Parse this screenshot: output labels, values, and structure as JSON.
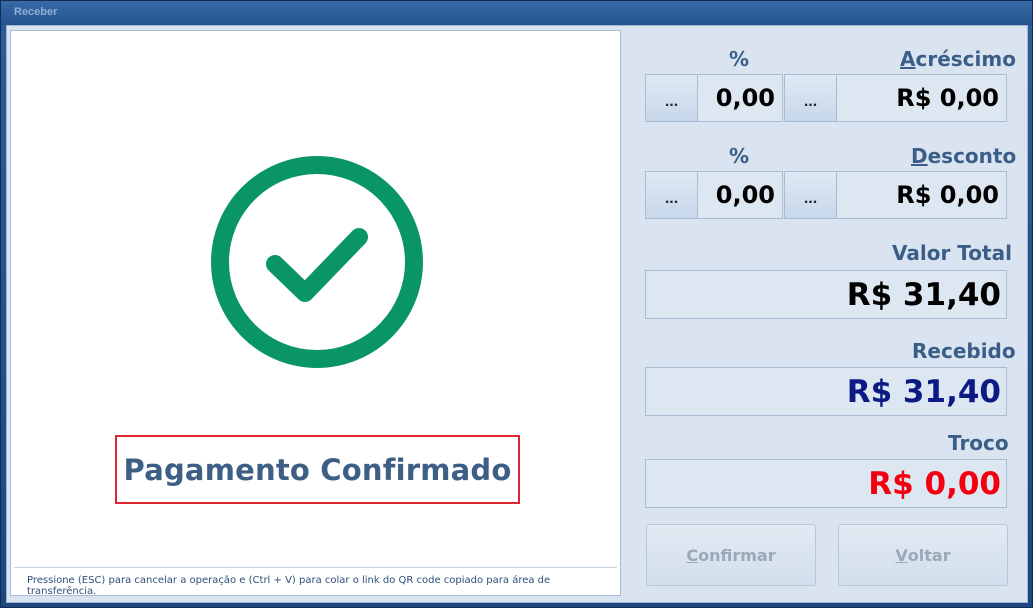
{
  "window": {
    "title": "Receber"
  },
  "status": {
    "message": "Pagamento Confirmado",
    "icon": "check-circle-icon",
    "icon_color": "#0a9567"
  },
  "hint": "Pressione (ESC) para cancelar a operação e (Ctrl + V) para colar o link do QR code copiado para área de transferência.",
  "acrescimo": {
    "percent_label": "%",
    "label_access": "A",
    "label_rest": "créscimo",
    "dots": "...",
    "percent_value": "0,00",
    "value": "R$ 0,00"
  },
  "desconto": {
    "percent_label": "%",
    "label_access": "D",
    "label_rest": "esconto",
    "dots": "...",
    "percent_value": "0,00",
    "value": "R$ 0,00"
  },
  "valor_total": {
    "label": "Valor Total",
    "value": "R$ 31,40",
    "color": "#000000"
  },
  "recebido": {
    "label": "Recebido",
    "value": "R$ 31,40",
    "color": "#0c1a86"
  },
  "troco": {
    "label": "Troco",
    "value": "R$ 0,00",
    "color": "#f2000f"
  },
  "buttons": {
    "confirmar_access": "C",
    "confirmar_rest": "onfirmar",
    "voltar_access": "V",
    "voltar_rest": "oltar"
  }
}
